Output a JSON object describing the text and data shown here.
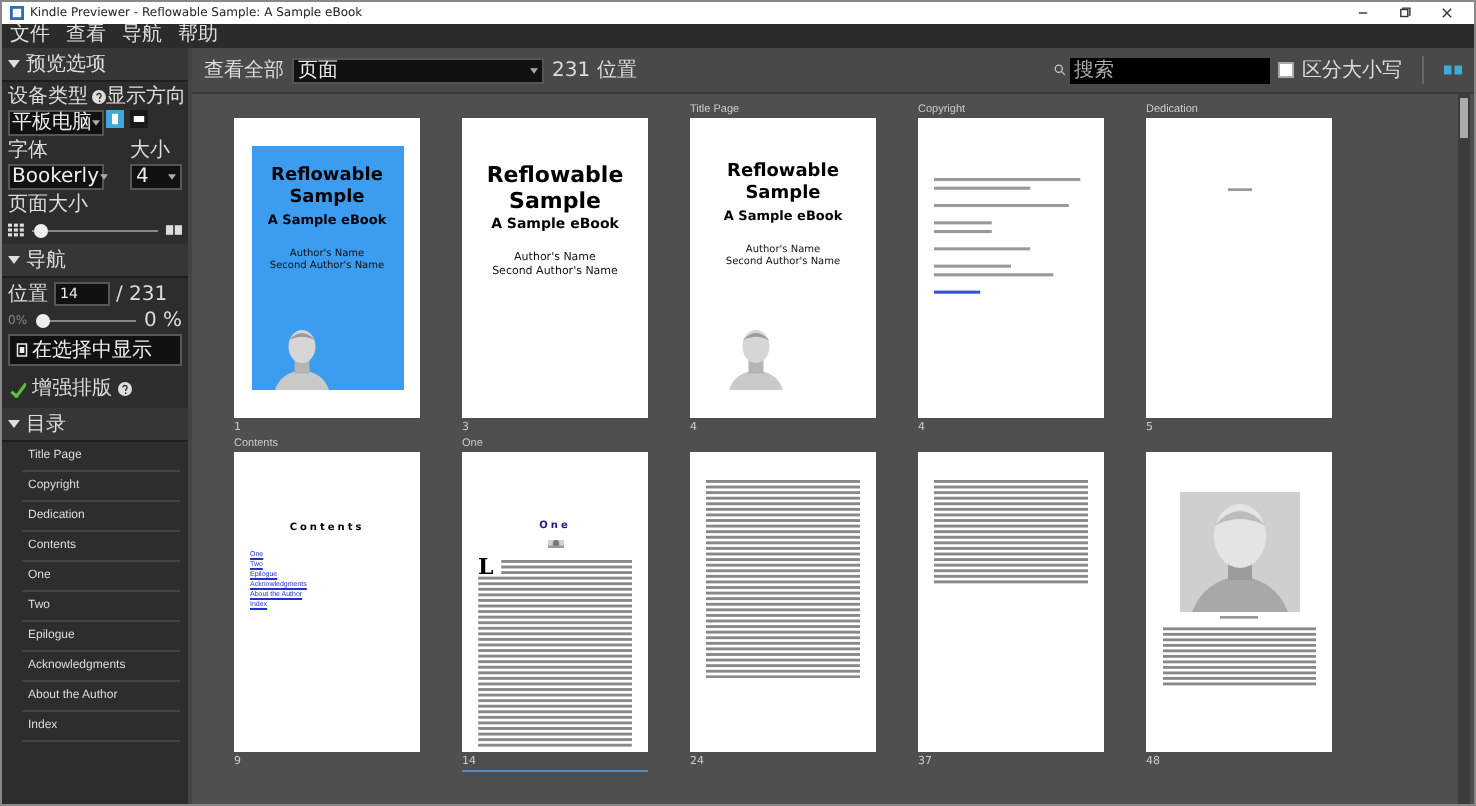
{
  "window": {
    "title": "Kindle Previewer - Reflowable Sample: A Sample eBook"
  },
  "menu": [
    "文件",
    "查看",
    "导航",
    "帮助"
  ],
  "sidebar": {
    "preview_section": {
      "title": "预览选项",
      "expanded": true
    },
    "device_label": "设备类型",
    "device_value": "平板电脑",
    "orientation_label": "显示方向",
    "orientation": [
      {
        "kind": "portrait",
        "selected": true
      },
      {
        "kind": "landscape",
        "selected": false
      }
    ],
    "font_label": "字体",
    "font_value": "Bookerly",
    "size_label": "大小",
    "size_value": "4",
    "page_size_label": "页面大小",
    "page_size": {
      "level": 0.06
    },
    "nav_section": {
      "title": "导航",
      "expanded": true
    },
    "location_label": "位置",
    "location_value": "14",
    "location_total": "/ 231",
    "progress_label": "0%",
    "progress": {
      "level": 0.06
    },
    "progress_reading": "0 %",
    "show_button": "在选择中显示",
    "typesetting": {
      "label": "增强排版",
      "on": true
    },
    "toc_section": {
      "title": "目录",
      "expanded": true
    },
    "toc": [
      "Title Page",
      "Copyright",
      "Dedication",
      "Contents",
      "One",
      "Two",
      "Epilogue",
      "Acknowledgments",
      "About the Author",
      "Index"
    ]
  },
  "toolbar": {
    "view_label": "查看全部",
    "view_value": "页面",
    "count": "231 位置",
    "search_placeholder": "搜索",
    "match_case": {
      "label": "区分大小写",
      "checked": false
    }
  },
  "pages": [
    {
      "kind": "cover",
      "number": "1",
      "selected": false,
      "title": "Reflowable Sample",
      "subtitle": "A Sample eBook",
      "authors": [
        "Author's Name",
        "Second Author's Name"
      ]
    },
    {
      "kind": "title",
      "number": "3",
      "selected": false,
      "title": "Reflowable Sample",
      "subtitle": "A Sample eBook",
      "authors": [
        "Author's Name",
        "Second Author's Name"
      ]
    },
    {
      "kind": "title_image",
      "caption": "Title Page",
      "number": "4",
      "selected": false,
      "title": "Reflowable Sample",
      "subtitle": "A Sample eBook",
      "authors": [
        "Author's Name",
        "Second Author's Name"
      ]
    },
    {
      "kind": "copyright",
      "caption": "Copyright",
      "number": "4",
      "selected": false
    },
    {
      "kind": "dedication",
      "caption": "Dedication",
      "number": "5",
      "selected": false
    },
    {
      "kind": "contents",
      "caption": "Contents",
      "number": "9",
      "selected": false,
      "heading": "Contents",
      "links": [
        "One",
        "Two",
        "Epilogue",
        "Acknowledgments",
        "About the Author",
        "Index"
      ]
    },
    {
      "kind": "chapter",
      "caption": "One",
      "number": "14",
      "selected": true,
      "heading": "One",
      "dropcap": "L"
    },
    {
      "kind": "text",
      "number": "24",
      "selected": false
    },
    {
      "kind": "text",
      "number": "37",
      "selected": false
    },
    {
      "number": "48",
      "selected": false
    }
  ]
}
